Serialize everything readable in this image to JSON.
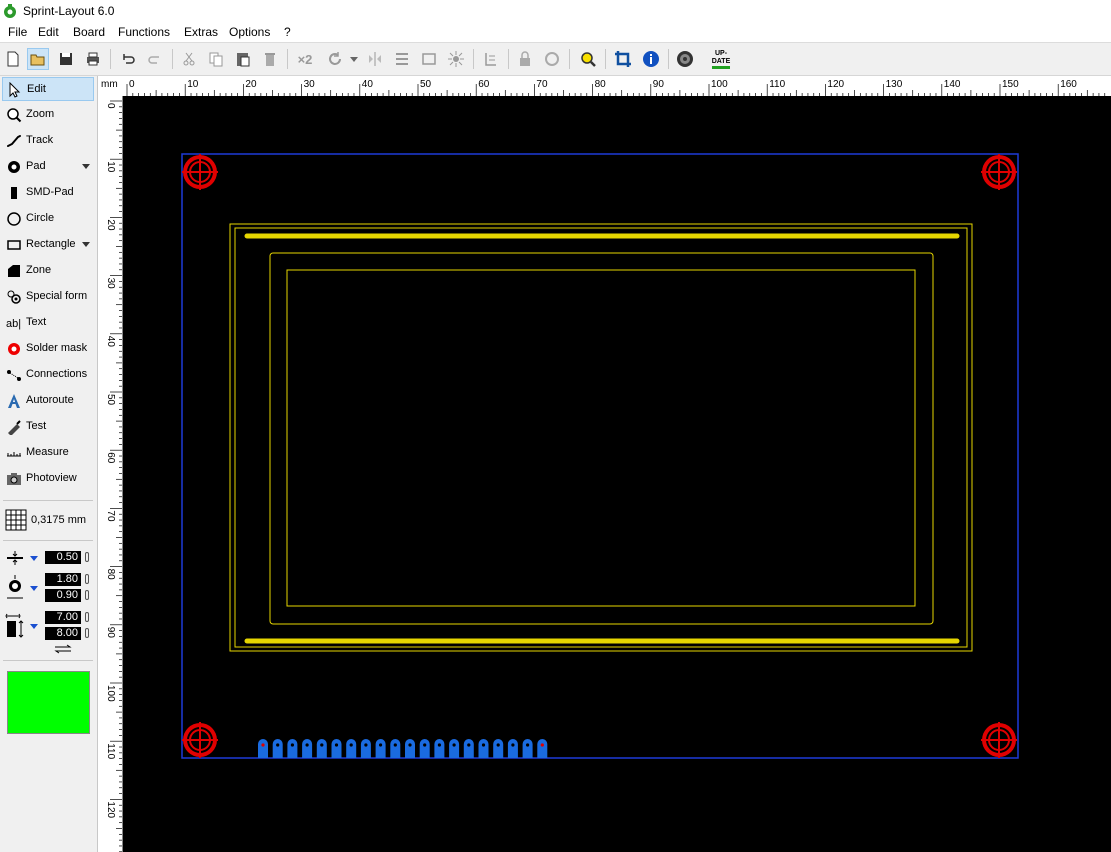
{
  "window": {
    "title": "Sprint-Layout 6.0"
  },
  "menu": [
    "File",
    "Edit",
    "Board",
    "Functions",
    "Extras",
    "Options",
    "?"
  ],
  "toolbar": {
    "icons": [
      "new-icon",
      "open-icon",
      "save-icon",
      "print-icon",
      "undo-icon",
      "redo-icon",
      "cut-icon",
      "copy-icon",
      "paste-icon",
      "delete-icon",
      "duplicate-icon",
      "rotate-icon",
      "mirror-icon",
      "align-icon",
      "group-icon",
      "explode-icon",
      "properties-icon",
      "lock-icon",
      "unlock-icon",
      "zoom-icon",
      "crop-icon",
      "info-icon",
      "gear-icon",
      "update-icon"
    ],
    "duplicate_label": "×2",
    "update_label_top": "UP-",
    "update_label_bottom": "DATE"
  },
  "tools": [
    {
      "label": "Edit",
      "icon": "pointer-icon",
      "active": true,
      "dropdown": false
    },
    {
      "label": "Zoom",
      "icon": "magnifier-icon",
      "active": false,
      "dropdown": false
    },
    {
      "label": "Track",
      "icon": "track-icon",
      "active": false,
      "dropdown": false
    },
    {
      "label": "Pad",
      "icon": "pad-icon",
      "active": false,
      "dropdown": true
    },
    {
      "label": "SMD-Pad",
      "icon": "smd-pad-icon",
      "active": false,
      "dropdown": false
    },
    {
      "label": "Circle",
      "icon": "circle-icon",
      "active": false,
      "dropdown": false
    },
    {
      "label": "Rectangle",
      "icon": "rectangle-icon",
      "active": false,
      "dropdown": true
    },
    {
      "label": "Zone",
      "icon": "zone-icon",
      "active": false,
      "dropdown": false
    },
    {
      "label": "Special form",
      "icon": "special-form-icon",
      "active": false,
      "dropdown": false
    },
    {
      "label": "Text",
      "icon": "text-icon",
      "active": false,
      "dropdown": false
    },
    {
      "label": "Solder mask",
      "icon": "solder-mask-icon",
      "active": false,
      "dropdown": false
    },
    {
      "label": "Connections",
      "icon": "connections-icon",
      "active": false,
      "dropdown": false
    },
    {
      "label": "Autoroute",
      "icon": "autoroute-icon",
      "active": false,
      "dropdown": false
    },
    {
      "label": "Test",
      "icon": "test-icon",
      "active": false,
      "dropdown": false
    },
    {
      "label": "Measure",
      "icon": "measure-icon",
      "active": false,
      "dropdown": false
    },
    {
      "label": "Photoview",
      "icon": "photoview-icon",
      "active": false,
      "dropdown": false
    }
  ],
  "grid": {
    "value": "0,3175 mm"
  },
  "params": {
    "track_width": "0.50",
    "pad_outer": "1.80",
    "pad_inner": "0.90",
    "smd_width": "7.00",
    "smd_height": "8.00"
  },
  "layer_color": "#00ff00",
  "ruler": {
    "unit": "mm",
    "top_labels": [
      "0",
      "10",
      "20",
      "30",
      "40",
      "50",
      "60",
      "70",
      "80",
      "90",
      "100",
      "110",
      "120",
      "130",
      "140",
      "150",
      "160"
    ],
    "left_labels": [
      "0",
      "10",
      "20",
      "30",
      "40",
      "50",
      "60",
      "70",
      "80",
      "90",
      "100",
      "110",
      "120"
    ]
  },
  "colors": {
    "canvas": "#000000",
    "board_outline": "#1e3ad8",
    "silkscreen": "#e6d600",
    "mount_holes": "#e00000",
    "pads": "#1a6be0"
  },
  "pads": {
    "count": 20
  }
}
